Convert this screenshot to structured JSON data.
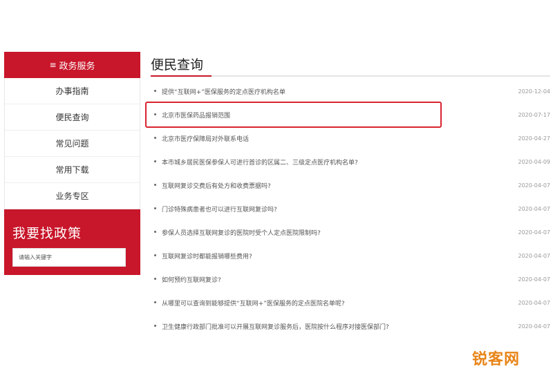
{
  "sidebar": {
    "header_icon": "≡",
    "header_label": "政务服务",
    "items": [
      {
        "label": "办事指南"
      },
      {
        "label": "便民查询"
      },
      {
        "label": "常见问题"
      },
      {
        "label": "常用下载"
      },
      {
        "label": "业务专区"
      }
    ],
    "policy_title": "我要找政策",
    "search_placeholder": "请输入关键字"
  },
  "main": {
    "title": "便民查询",
    "items": [
      {
        "text": "提供“互联网+”医保服务的定点医疗机构名单",
        "date": "2020-12-04"
      },
      {
        "text": "北京市医保药品报销范围",
        "date": "2020-07-17"
      },
      {
        "text": "北京市医疗保障局对外联系电话",
        "date": "2020-04-27"
      },
      {
        "text": "本市城乡居民医保参保人可进行首诊的区属二、三级定点医疗机构名单?",
        "date": "2020-04-09"
      },
      {
        "text": "互联网复诊交费后有处方和收费票据吗?",
        "date": "2020-04-07"
      },
      {
        "text": "门诊特殊病患者也可以进行互联网复诊吗?",
        "date": "2020-04-07"
      },
      {
        "text": "参保人员选择互联网复诊的医院时受个人定点医院限制吗?",
        "date": "2020-04-07"
      },
      {
        "text": "互联网复诊时都能报销哪些费用?",
        "date": "2020-04-07"
      },
      {
        "text": "如何预约互联网复诊?",
        "date": "2020-04-07"
      },
      {
        "text": "从哪里可以查询到能够提供“互联网+”医保服务的定点医院名单呢?",
        "date": "2020-04-07"
      },
      {
        "text": "卫生健康行政部门批准可以开展互联网复诊服务后，医院按什么程序对接医保部门?",
        "date": "2020-04-07"
      }
    ]
  },
  "watermark": "锐客网",
  "colors": {
    "accent": "#c8162a",
    "highlight_border": "#d9232e",
    "watermark": "#e88417"
  }
}
